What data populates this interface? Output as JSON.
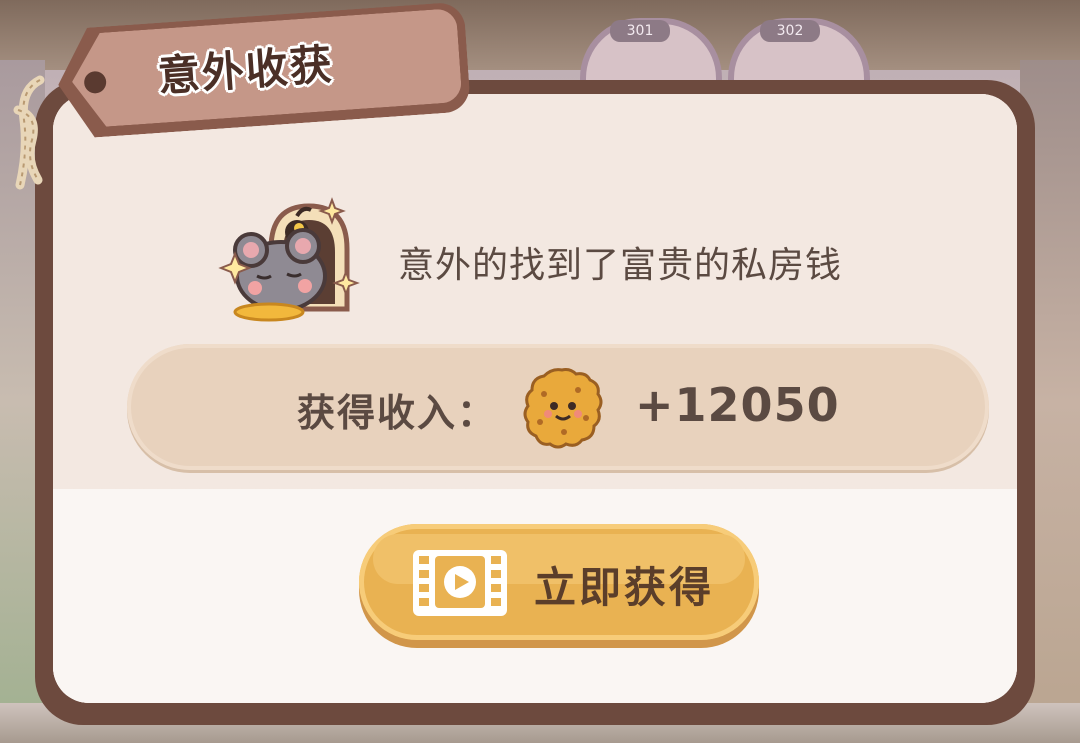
{
  "scene": {
    "room_labels": [
      "301",
      "302"
    ]
  },
  "dialog": {
    "title": "意外收获",
    "message": "意外的找到了富贵的私房钱",
    "income_label": "获得收入：",
    "income_value": "+12050",
    "claim_button_label": "立即获得",
    "icons": {
      "event_icon": "mouse-sleeping-with-coin-icon",
      "currency_icon": "cookie-coin-icon",
      "video_icon": "video-play-icon"
    },
    "colors": {
      "frame": "#6d4a3e",
      "panel": "#f3e8e1",
      "income_pill": "#e8d2bd",
      "button": "#e9b252",
      "text": "#5b4a42"
    }
  }
}
